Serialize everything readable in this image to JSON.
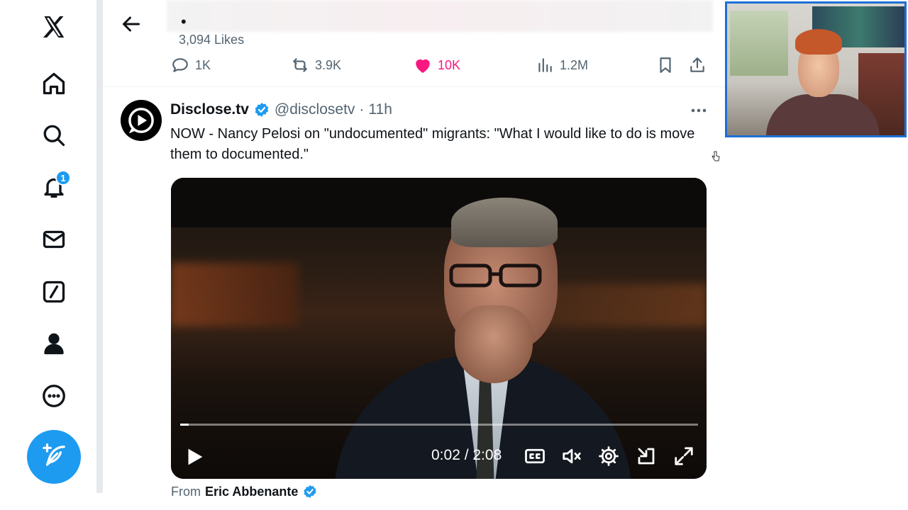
{
  "nav": {
    "items": [
      {
        "id": "logo",
        "icon": "x-logo-icon"
      },
      {
        "id": "home",
        "icon": "home-icon"
      },
      {
        "id": "explore",
        "icon": "search-icon"
      },
      {
        "id": "notifications",
        "icon": "bell-icon"
      },
      {
        "id": "messages",
        "icon": "mail-icon"
      },
      {
        "id": "grok",
        "icon": "slash-box-icon"
      },
      {
        "id": "profile",
        "icon": "person-icon"
      },
      {
        "id": "more",
        "icon": "more-circle-icon"
      }
    ],
    "notifications_badge": "1",
    "compose_icon": "feather-plus-icon"
  },
  "previous_tweet": {
    "text_fragment": "•",
    "likes_line": "3,094 Likes",
    "actions": {
      "replies": "1K",
      "reposts": "3.9K",
      "likes": "10K",
      "views": "1.2M"
    },
    "like_color": "#f91880"
  },
  "tweet": {
    "author_name": "Disclose.tv",
    "verified": true,
    "handle": "@disclosetv",
    "separator": "·",
    "time": "11h",
    "text": "NOW - Nancy Pelosi on \"undocumented\" migrants: \"What I would like to do is move them to documented.\"",
    "video": {
      "current_time": "0:02",
      "duration": "2:08",
      "time_display": "0:02 / 2:08",
      "progress_fraction": 0.016,
      "muted": true
    },
    "from_prefix": "From",
    "from_name": "Eric Abbenante"
  },
  "colors": {
    "accent": "#1d9bf0",
    "text": "#0f1419",
    "secondary_text": "#536471",
    "webcam_border": "#1d6fd6"
  }
}
